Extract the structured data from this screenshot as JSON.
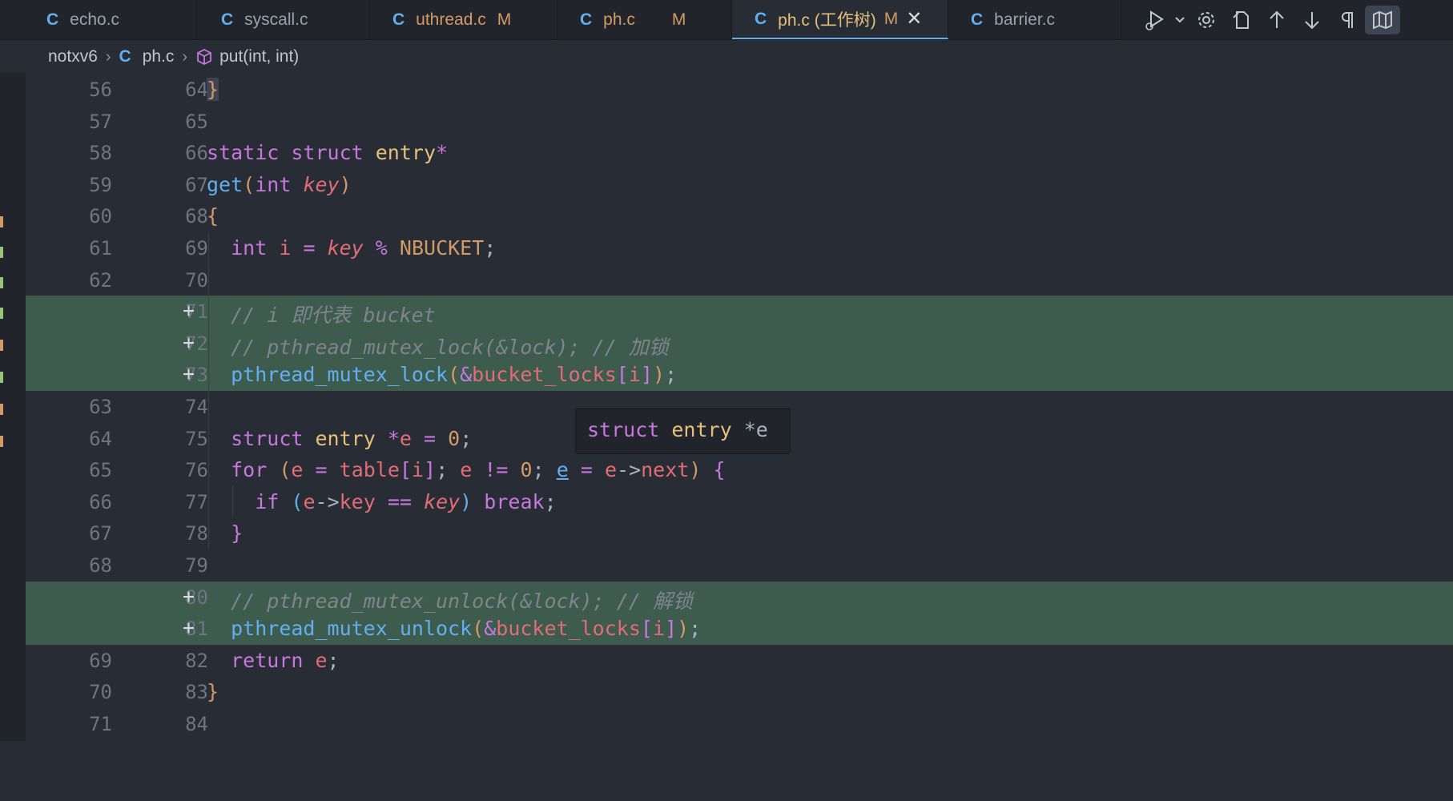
{
  "tabs": [
    {
      "icon": "C",
      "name": "echo.c",
      "modified": false,
      "active": false
    },
    {
      "icon": "C",
      "name": "syscall.c",
      "modified": false,
      "active": false
    },
    {
      "icon": "C",
      "name": "uthread.c",
      "badge": "M",
      "modified": true,
      "active": false
    },
    {
      "icon": "C",
      "name": "ph.c",
      "badge": "M",
      "modified": true,
      "active": false
    },
    {
      "icon": "C",
      "name": "ph.c (工作树)",
      "badge": "M",
      "modified": true,
      "active": true,
      "close": "✕"
    },
    {
      "icon": "C",
      "name": "barrier.c",
      "modified": false,
      "active": false
    }
  ],
  "breadcrumb": {
    "folder": "notxv6",
    "file_icon": "C",
    "file": "ph.c",
    "symbol": "put(int, int)"
  },
  "hover": {
    "type": "struct",
    "name": "entry",
    "var": " *e"
  },
  "lines": [
    {
      "old": "56",
      "new": "64",
      "plus": "",
      "added": false
    },
    {
      "old": "57",
      "new": "65",
      "plus": "",
      "added": false
    },
    {
      "old": "58",
      "new": "66",
      "plus": "",
      "added": false
    },
    {
      "old": "59",
      "new": "67",
      "plus": "",
      "added": false
    },
    {
      "old": "60",
      "new": "68",
      "plus": "",
      "added": false
    },
    {
      "old": "61",
      "new": "69",
      "plus": "",
      "added": false
    },
    {
      "old": "62",
      "new": "70",
      "plus": "",
      "added": false
    },
    {
      "old": "",
      "new": "71",
      "plus": "+",
      "added": true
    },
    {
      "old": "",
      "new": "72",
      "plus": "+",
      "added": true
    },
    {
      "old": "",
      "new": "73",
      "plus": "+",
      "added": true
    },
    {
      "old": "63",
      "new": "74",
      "plus": "",
      "added": false
    },
    {
      "old": "64",
      "new": "75",
      "plus": "",
      "added": false
    },
    {
      "old": "65",
      "new": "76",
      "plus": "",
      "added": false
    },
    {
      "old": "66",
      "new": "77",
      "plus": "",
      "added": false
    },
    {
      "old": "67",
      "new": "78",
      "plus": "",
      "added": false
    },
    {
      "old": "68",
      "new": "79",
      "plus": "",
      "added": false
    },
    {
      "old": "",
      "new": "80",
      "plus": "+",
      "added": true
    },
    {
      "old": "",
      "new": "81",
      "plus": "+",
      "added": true
    },
    {
      "old": "69",
      "new": "82",
      "plus": "",
      "added": false
    },
    {
      "old": "70",
      "new": "83",
      "plus": "",
      "added": false
    },
    {
      "old": "71",
      "new": "84",
      "plus": "",
      "added": false
    }
  ],
  "code": {
    "l0": "}",
    "l2a": "static",
    "l2b": "struct",
    "l2c": "entry",
    "l2d": "*",
    "l3a": "get",
    "l3b": "(",
    "l3c": "int",
    "l3d": "key",
    "l3e": ")",
    "l4": "{",
    "l5a": "int",
    "l5b": "i",
    "l5c": "=",
    "l5d": "key",
    "l5e": "%",
    "l5f": "NBUCKET",
    "l5g": ";",
    "l7": "// i 即代表 bucket",
    "l8": "// pthread_mutex_lock(&lock); // 加锁",
    "l9a": "pthread_mutex_lock",
    "l9b": "(",
    "l9c": "&",
    "l9d": "bucket_locks",
    "l9e": "[",
    "l9f": "i",
    "l9g": "]",
    "l9h": ")",
    "l9i": ";",
    "l11a": "struct",
    "l11b": "entry",
    "l11c": "*",
    "l11d": "e",
    "l11e": "=",
    "l11f": "0",
    "l11g": ";",
    "l12a": "for",
    "l12b": "(",
    "l12c": "e",
    "l12d": "=",
    "l12e": "table",
    "l12f": "[",
    "l12g": "i",
    "l12h": "]",
    "l12i": ";",
    "l12j": "e",
    "l12k": "!=",
    "l12l": "0",
    "l12m": ";",
    "l12n": "e",
    "l12o": "=",
    "l12p": "e",
    "l12q": "->",
    "l12r": "next",
    "l12s": ")",
    "l12t": "{",
    "l13a": "if",
    "l13b": "(",
    "l13c": "e",
    "l13d": "->",
    "l13e": "key",
    "l13f": "==",
    "l13g": "key",
    "l13h": ")",
    "l13i": "break",
    "l13j": ";",
    "l14": "}",
    "l16": "// pthread_mutex_unlock(&lock); // 解锁",
    "l17a": "pthread_mutex_unlock",
    "l17b": "(",
    "l17c": "&",
    "l17d": "bucket_locks",
    "l17e": "[",
    "l17f": "i",
    "l17g": "]",
    "l17h": ")",
    "l17i": ";",
    "l18a": "return",
    "l18b": "e",
    "l18c": ";",
    "l19": "}"
  },
  "colors": {
    "keyword": "#c678dd",
    "type": "#e5c07b",
    "function": "#61afef",
    "variable": "#e06c75",
    "number": "#d19a66",
    "comment": "#7f848e",
    "added_bg": "#3e5c4e",
    "editor_bg": "#282c34"
  },
  "toolbar_icons": [
    "run-debug-icon",
    "chevron-down-icon",
    "gear-icon",
    "open-changes-icon",
    "arrow-up-icon",
    "arrow-down-icon",
    "pilcrow-icon",
    "minimap-icon"
  ]
}
